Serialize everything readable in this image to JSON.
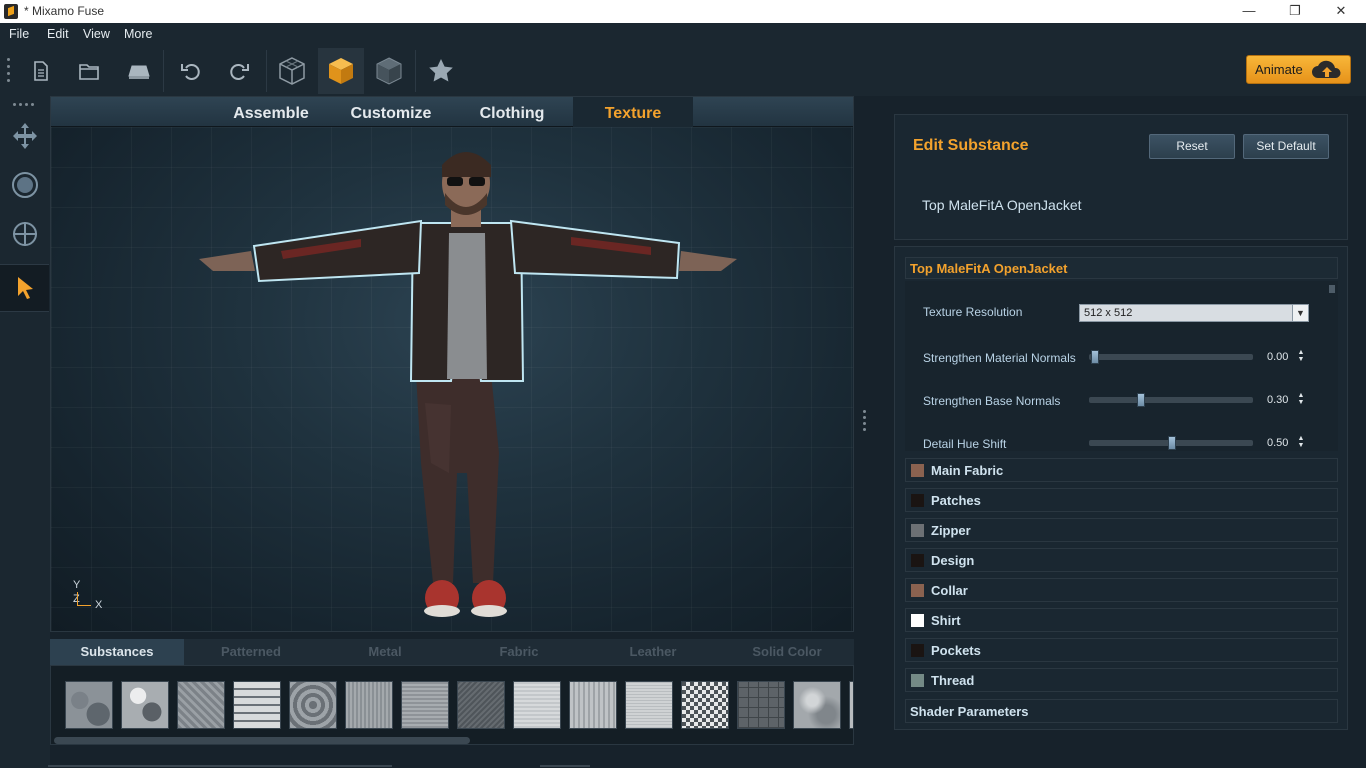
{
  "window": {
    "title": "* Mixamo Fuse",
    "controls": [
      "—",
      "❐",
      "✕"
    ]
  },
  "menu": {
    "items": [
      "File",
      "Edit",
      "View",
      "More"
    ]
  },
  "toolbar": {
    "animate_label": "Animate"
  },
  "viewport": {
    "tabs": [
      "Assemble",
      "Customize",
      "Clothing",
      "Texture"
    ],
    "active_tab": "Texture",
    "axis": {
      "y": "Y",
      "z": "Z",
      "x": "X"
    }
  },
  "materials": {
    "tabs": [
      "Substances",
      "Patterned",
      "Metal",
      "Fabric",
      "Leather",
      "Solid Color"
    ],
    "active_tab": "Substances"
  },
  "edit_substance": {
    "title": "Edit Substance",
    "reset_label": "Reset",
    "set_default_label": "Set Default",
    "subtitle": "Top MaleFitA OpenJacket"
  },
  "substance_panel": {
    "section_title": "Top MaleFitA OpenJacket",
    "params": {
      "texture_resolution": {
        "label": "Texture Resolution",
        "value": "512 x 512"
      },
      "sliders": [
        {
          "label": "Strengthen Material Normals",
          "value": "0.00",
          "level": 0.0
        },
        {
          "label": "Strengthen Base Normals",
          "value": "0.30",
          "level": 0.3
        },
        {
          "label": "Detail Hue Shift",
          "value": "0.50",
          "level": 0.5
        }
      ]
    },
    "layers": [
      {
        "name": "Main Fabric",
        "color": "#8a6250"
      },
      {
        "name": "Patches",
        "color": "#1a1412"
      },
      {
        "name": "Zipper",
        "color": "#6c7074"
      },
      {
        "name": "Design",
        "color": "#1a1412"
      },
      {
        "name": "Collar",
        "color": "#8a6250"
      },
      {
        "name": "Shirt",
        "color": "#ffffff"
      },
      {
        "name": "Pockets",
        "color": "#1a1412"
      },
      {
        "name": "Thread",
        "color": "#748a86"
      }
    ],
    "shader_title": "Shader Parameters"
  },
  "colors": {
    "accent": "#f3a22d",
    "background": "#17222b"
  }
}
